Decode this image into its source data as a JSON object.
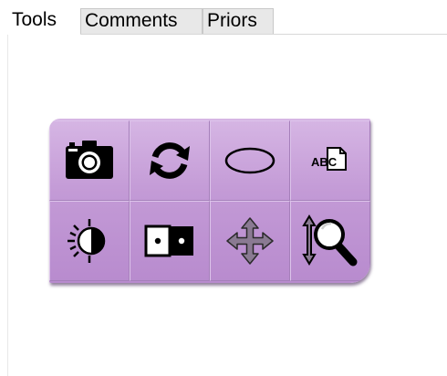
{
  "tabs": [
    {
      "label": "Tools",
      "active": true
    },
    {
      "label": "Comments",
      "active": false
    },
    {
      "label": "Priors",
      "active": false
    }
  ],
  "toolbar": {
    "background_color": "#c8a2da",
    "tools": [
      {
        "icon": "camera-icon"
      },
      {
        "icon": "refresh-icon"
      },
      {
        "icon": "ellipse-icon"
      },
      {
        "icon": "text-annotation-icon",
        "text": "ABC"
      },
      {
        "icon": "contrast-icon"
      },
      {
        "icon": "domino-icon"
      },
      {
        "icon": "pan-move-icon"
      },
      {
        "icon": "zoom-magnifier-icon"
      }
    ]
  }
}
